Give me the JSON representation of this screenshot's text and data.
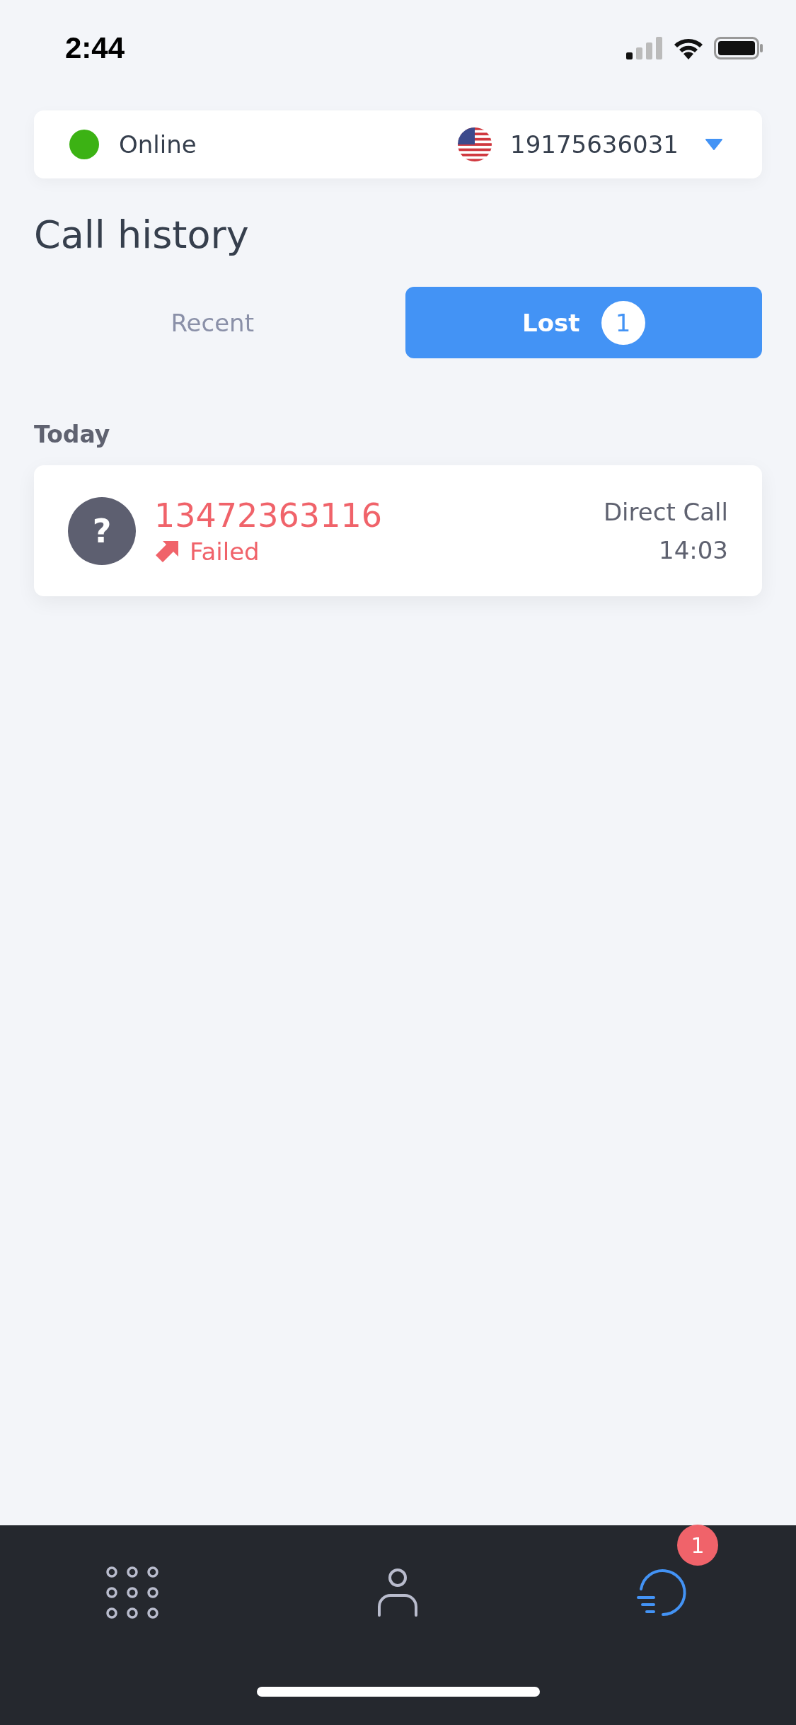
{
  "status_bar": {
    "time": "2:44"
  },
  "account": {
    "status": "Online",
    "online": true,
    "number": "19175636031"
  },
  "title": "Call history",
  "tabs": [
    {
      "label": "Recent",
      "selected": false
    },
    {
      "label": "Lost",
      "selected": true,
      "count": "1"
    }
  ],
  "sections": [
    {
      "heading": "Today",
      "calls": [
        {
          "avatar": "?",
          "number": "13472363116",
          "status": "Failed",
          "failed": true,
          "type": "Direct Call",
          "time": "14:03"
        }
      ]
    }
  ],
  "nav": [
    {
      "kind": "keypad",
      "selected": false
    },
    {
      "kind": "contacts",
      "selected": false
    },
    {
      "kind": "history",
      "selected": true,
      "badge": "1"
    }
  ]
}
